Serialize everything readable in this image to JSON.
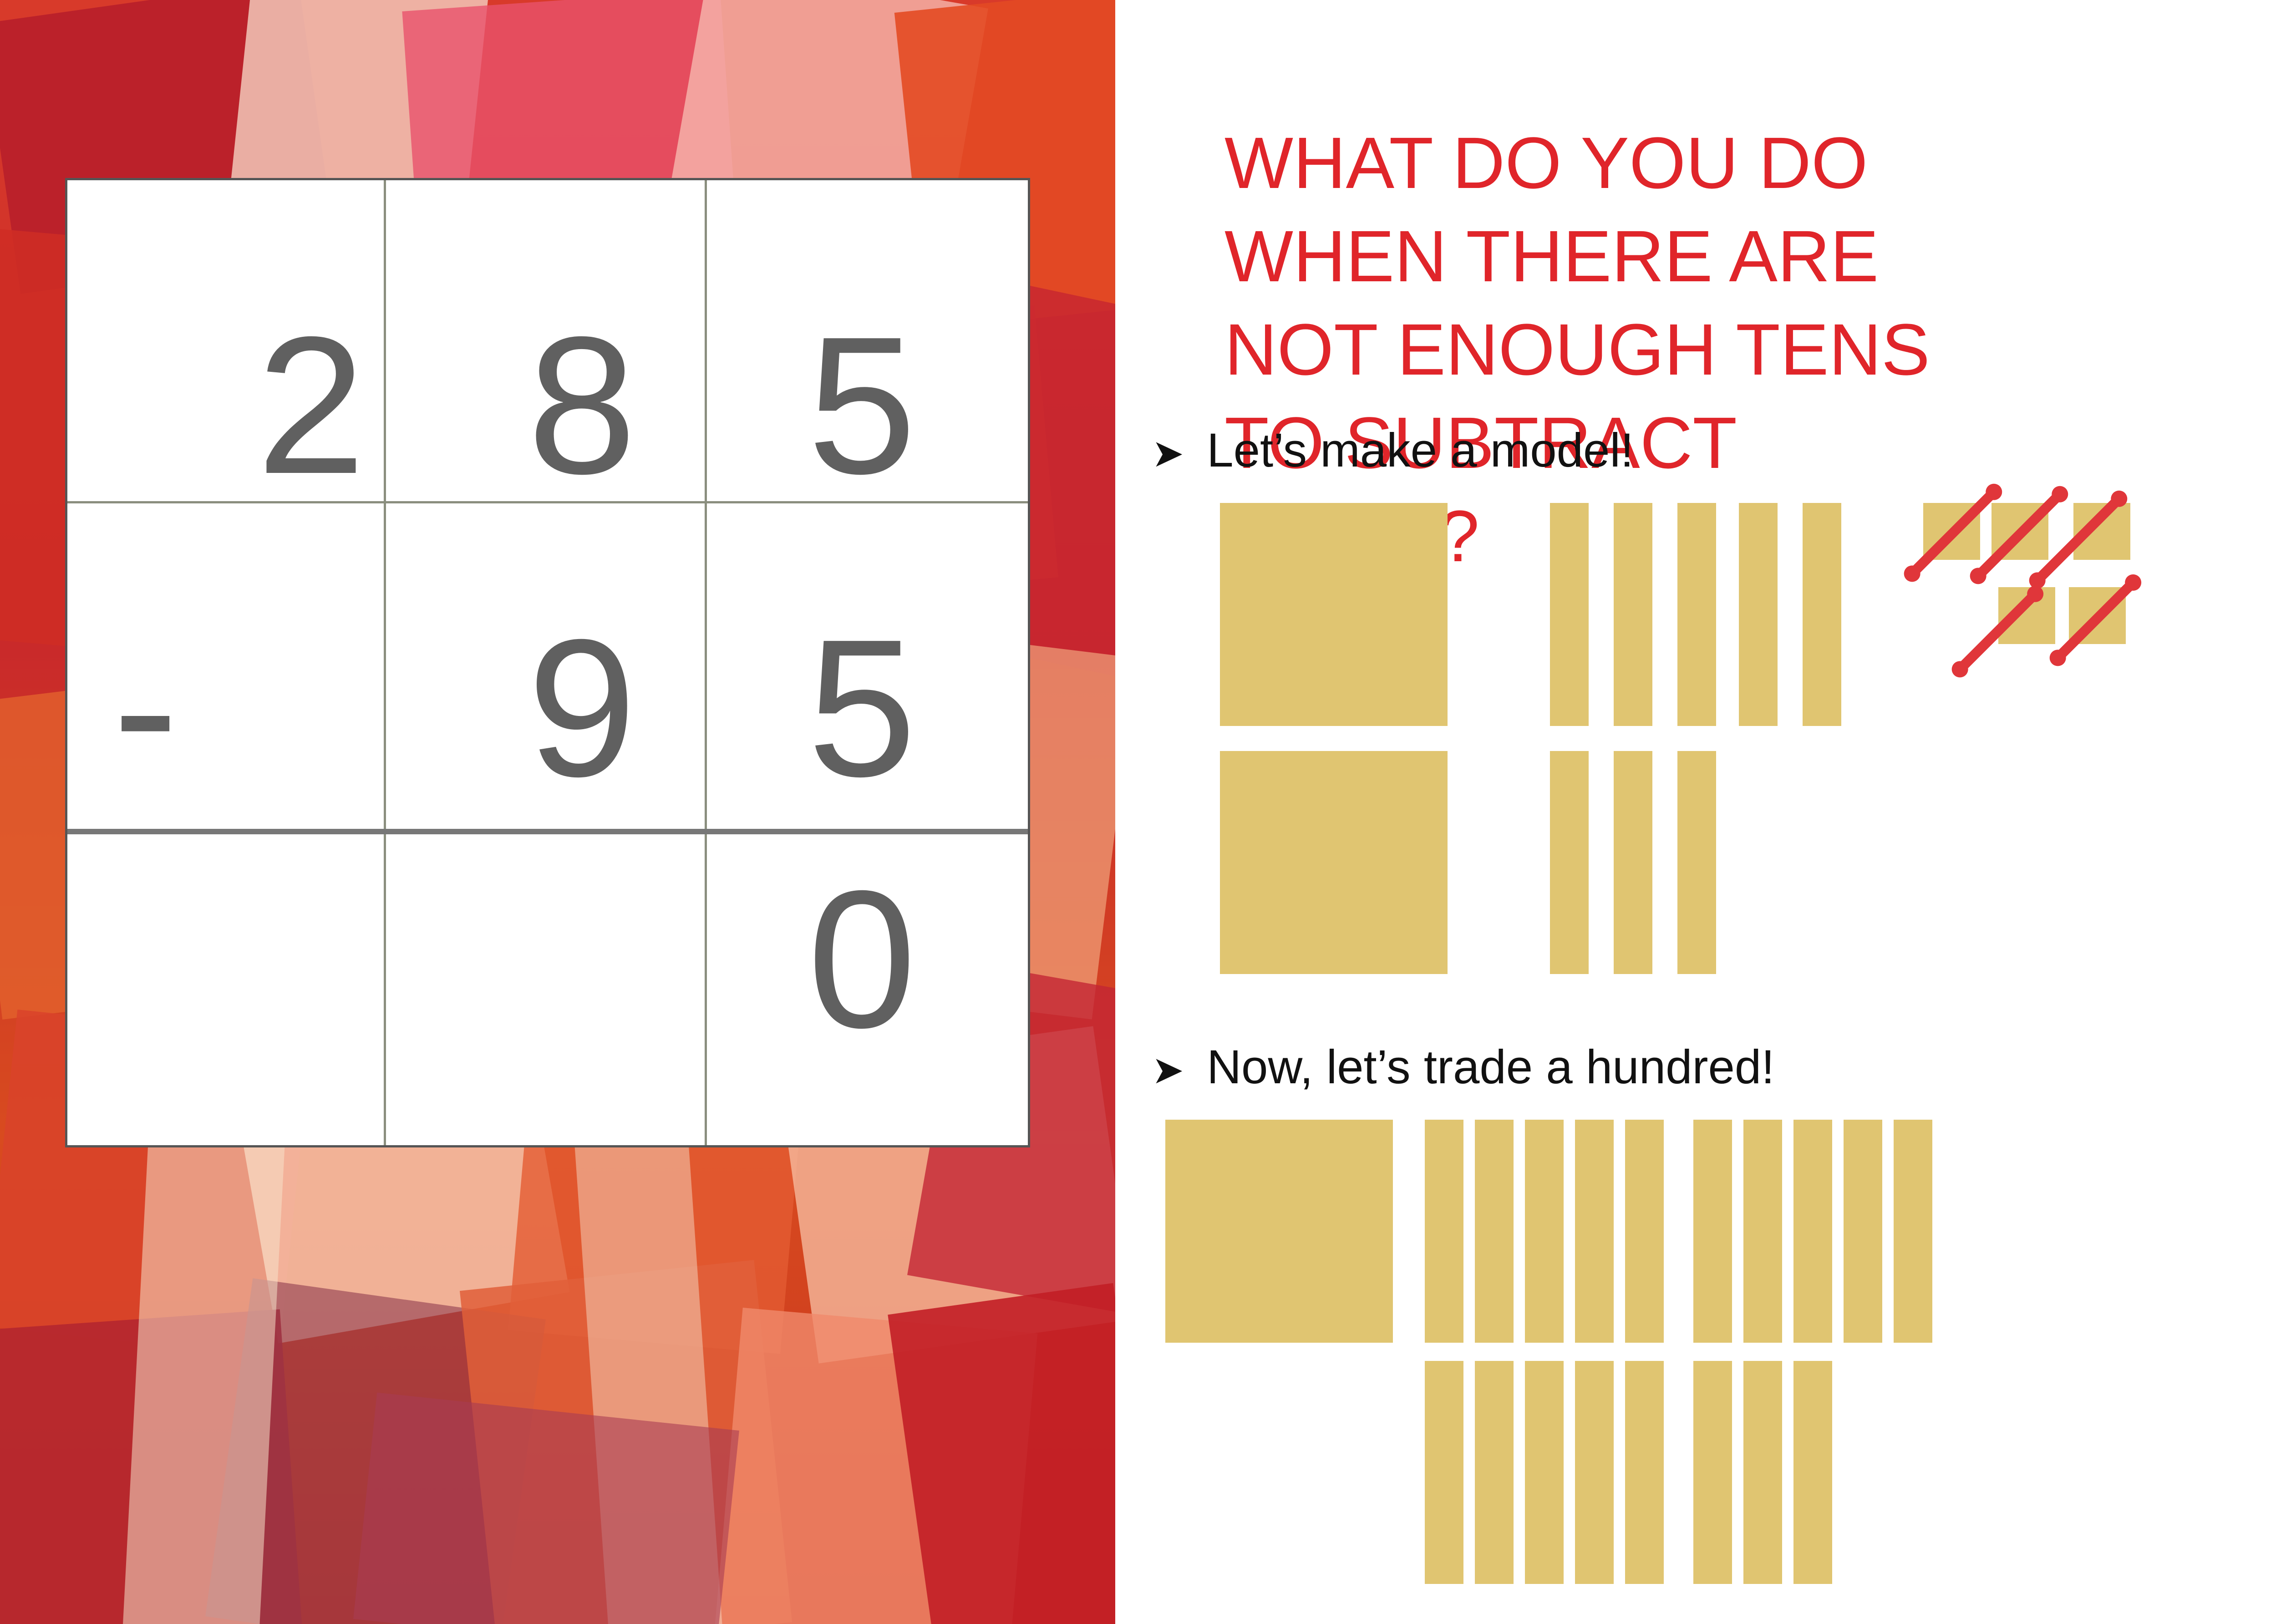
{
  "problem": {
    "row1": [
      "2",
      "8",
      "5"
    ],
    "row2_sign": "-",
    "row2": [
      "",
      "9",
      "5"
    ],
    "row3": [
      "",
      "",
      "0"
    ]
  },
  "title_lines": [
    "WHAT DO YOU DO",
    "WHEN THERE ARE",
    "NOT ENOUGH TENS",
    "TO SUBTRACT",
    "FROM?"
  ],
  "bullets": {
    "first": "Let’s make a model!",
    "second": "Now, let’s trade a hundred!"
  },
  "model_counts": {
    "hundreds": 2,
    "tens": 8,
    "ones": 5,
    "ones_crossed_out": 5
  },
  "traded_counts": {
    "hundreds": 1,
    "tens": 18
  },
  "colors": {
    "title": "#e0252a",
    "base_ten_block": "#e0c571",
    "cross_out": "#e0363a",
    "digit": "#606060"
  }
}
